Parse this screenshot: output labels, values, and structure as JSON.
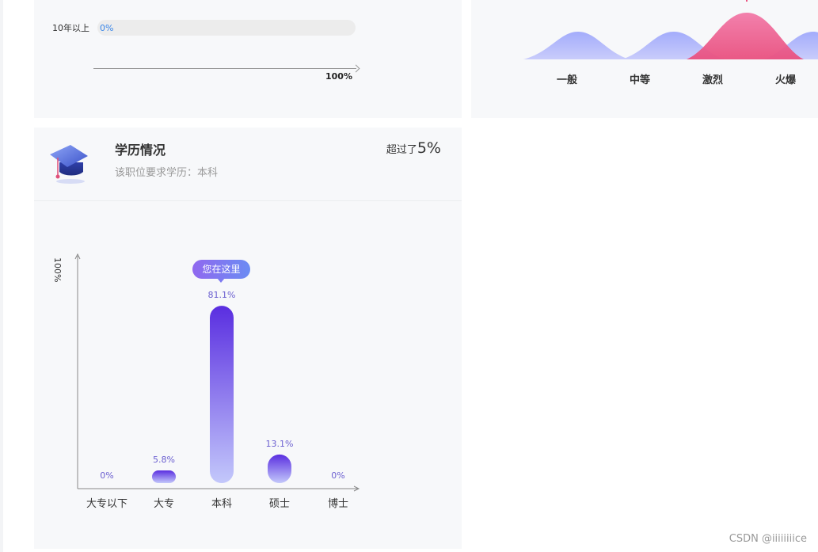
{
  "experience": {
    "row_label": "10年以上",
    "percent": 0,
    "percent_label": "0%",
    "axis_max_label": "100%"
  },
  "competition": {
    "levels": [
      "一般",
      "中等",
      "激烈",
      "火爆"
    ],
    "highlight": "激烈",
    "colors": {
      "normal": "#a7b0fb",
      "highlight": "#ef5e94"
    }
  },
  "education": {
    "title": "学历情况",
    "subtitle_prefix": "该职位要求学历：",
    "subtitle_value": "本科",
    "beat_prefix": "超过了",
    "beat_value": "5%",
    "tooltip": "您在这里",
    "highlight_category": "本科",
    "colors": {
      "bar_top": "#5a2ee0",
      "bar_bottom": "#c3c8fb",
      "value_label": "#6b5fd0"
    }
  },
  "chart_data": {
    "type": "bar",
    "ylabel": "100%",
    "ylim": [
      0,
      100
    ],
    "categories": [
      "大专以下",
      "大专",
      "本科",
      "硕士",
      "博士"
    ],
    "values": [
      0,
      5.8,
      81.1,
      13.1,
      0
    ],
    "value_labels": [
      "0%",
      "5.8%",
      "81.1%",
      "13.1%",
      "0%"
    ]
  },
  "watermark": "CSDN @iiiiiiiice"
}
